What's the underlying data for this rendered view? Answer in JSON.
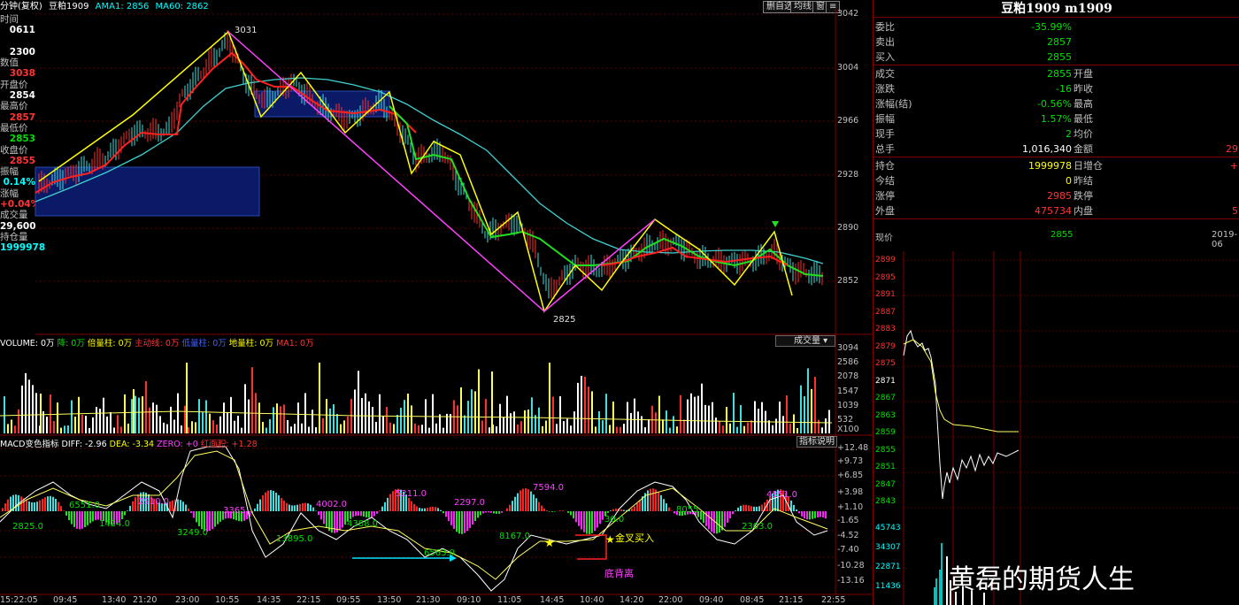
{
  "topbar": {
    "period": "分钟(复权)",
    "symbol": "豆粕1909",
    "ama1": "AMA1: 2856",
    "ma60": "MA60: 2862",
    "buttons": [
      "删自选",
      "均线",
      "窗"
    ]
  },
  "left_info": [
    {
      "label": "时间",
      "value": "0611"
    },
    {
      "label": "",
      "value": "2300"
    },
    {
      "label": "数值",
      "value": "3038"
    },
    {
      "label": "开盘价",
      "value": "2854"
    },
    {
      "label": "最高价",
      "value": "2857"
    },
    {
      "label": "最低价",
      "value": "2853"
    },
    {
      "label": "收盘价",
      "value": "2855"
    },
    {
      "label": "振幅",
      "value": "0.14%"
    },
    {
      "label": "涨幅",
      "value": "+0.04%"
    },
    {
      "label": "成交量",
      "value": "29,600"
    },
    {
      "label": "持仓量",
      "value": "1999978"
    }
  ],
  "price_axis": [
    "3042",
    "3004",
    "2966",
    "2928",
    "2890",
    "2852"
  ],
  "price_annotations": {
    "high": "3031",
    "low": "2825"
  },
  "volume_header": {
    "volume": "VOLUME: 0万",
    "drop": "降: 0万",
    "double": "倍量柱: 0万",
    "main": "主动线: 0万",
    "low_volume": "低量柱: 0万",
    "ground": "地量柱: 0万",
    "ma1": "MA1: 0万",
    "dropdown": "成交量"
  },
  "volume_axis": [
    "3094",
    "2586",
    "2078",
    "1547",
    "1039",
    "532",
    "X100"
  ],
  "macd_header": {
    "name": "MACD变色指标",
    "diff": "DIFF: -2.96",
    "dea": "DEA: -3.34",
    "zero": "ZERO: +0",
    "area": "红面积: +1.28",
    "button": "指标说明"
  },
  "macd_axis": [
    "+12.48",
    "+9.73",
    "+6.85",
    "+3.98",
    "+1.10",
    "-1.65",
    "-4.52",
    "-7.40",
    "-10.28",
    "-13.16"
  ],
  "macd_labels": [
    "6551.0",
    "2910.0",
    "4002.0",
    "5211.0",
    "2297.0",
    "7594.0",
    "4851.0",
    "2825.0",
    "1424.0",
    "3249.0",
    "13895.0",
    "4388.0",
    "8167.0",
    "30.0",
    "2303.0",
    "6563.0",
    "3365",
    "8055"
  ],
  "macd_notes": {
    "golden_cross": "金叉买入",
    "bottom_divergence": "底背离"
  },
  "time_axis": [
    "15:22:05",
    "09:45",
    "13:40",
    "21:20",
    "23:00",
    "10:55",
    "14:35",
    "22:15",
    "09:55",
    "13:50",
    "21:30",
    "09:10",
    "11:05",
    "14:45",
    "10:40",
    "14:20",
    "22:00",
    "09:40",
    "08:45",
    "21:15",
    "22:55"
  ],
  "quote": {
    "title": "豆粕1909 m1909",
    "rows1": [
      {
        "k": "委比",
        "v": "-35.99%",
        "c": "green"
      },
      {
        "k": "卖出",
        "v": "2857",
        "c": "green"
      },
      {
        "k": "买入",
        "v": "2855",
        "c": "green"
      }
    ],
    "rows2": [
      {
        "k": "成交",
        "v": "2855",
        "c": "green",
        "k2": "开盘",
        "v2": ""
      },
      {
        "k": "涨跌",
        "v": "-16",
        "c": "green",
        "k2": "昨收",
        "v2": ""
      },
      {
        "k": "涨幅(结)",
        "v": "-0.56%",
        "c": "green",
        "k2": "最高",
        "v2": ""
      },
      {
        "k": "振幅",
        "v": "1.57%",
        "c": "green",
        "k2": "最低",
        "v2": ""
      },
      {
        "k": "现手",
        "v": "2",
        "c": "green",
        "k2": "均价",
        "v2": ""
      },
      {
        "k": "总手",
        "v": "1,016,340",
        "c": "white",
        "k2": "金额",
        "v2": "29"
      }
    ],
    "rows3": [
      {
        "k": "持仓",
        "v": "1999978",
        "c": "yellow",
        "k2": "日增仓",
        "v2": "+"
      },
      {
        "k": "今结",
        "v": "0",
        "c": "yellow",
        "k2": "昨结",
        "v2": ""
      },
      {
        "k": "涨停",
        "v": "2985",
        "c": "red",
        "k2": "跌停",
        "v2": ""
      },
      {
        "k": "外盘",
        "v": "475734",
        "c": "red",
        "k2": "内盘",
        "v2": "5"
      }
    ],
    "now_label": "现价",
    "now_value": "2855",
    "now_date": "2019-06"
  },
  "intraday_axis": [
    "2899",
    "2895",
    "2891",
    "2887",
    "2883",
    "2879",
    "2875",
    "2871",
    "2867",
    "2863",
    "2859",
    "2855",
    "2851",
    "2847",
    "2843"
  ],
  "intraday_vol_axis": [
    "45743",
    "34307",
    "22871",
    "11436"
  ],
  "watermark": "黄磊的期货人生"
}
